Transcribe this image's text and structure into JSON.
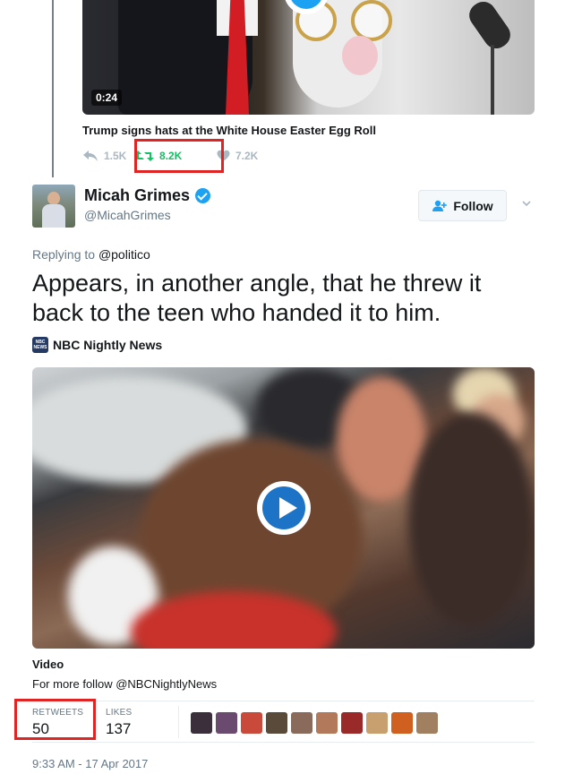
{
  "quoted_media": {
    "duration": "0:24",
    "caption": "Trump signs hats at the White House Easter Egg Roll"
  },
  "quoted_actions": {
    "replies": "1.5K",
    "retweets": "8.2K",
    "likes": "7.2K"
  },
  "tweet": {
    "name": "Micah Grimes",
    "handle": "@MicahGrimes",
    "follow_label": "Follow",
    "replying_prefix": "Replying to",
    "replying_to": "@politico",
    "text": "Appears, in another angle, that he threw it back to the teen who handed it to him.",
    "source_name": "NBC Nightly News",
    "source_logo_text": "NBC NEWS",
    "video_label": "Video",
    "video_description": "For more follow @NBCNightlyNews",
    "timestamp": "9:33 AM - 17 Apr 2017"
  },
  "stats": {
    "retweets_label": "RETWEETS",
    "retweets_value": "50",
    "likes_label": "LIKES",
    "likes_value": "137"
  },
  "colors": {
    "retweet_green": "#17bf63",
    "accent_blue": "#1da1f2",
    "highlight_red": "#e02424",
    "muted_gray": "#657786"
  },
  "liker_avatar_colors": [
    "#3a2f3a",
    "#6a4a6e",
    "#c94a3a",
    "#5a4a3a",
    "#8a6a5a",
    "#b27a5a",
    "#9a2a2a",
    "#c8a070",
    "#d06020",
    "#a08060"
  ]
}
